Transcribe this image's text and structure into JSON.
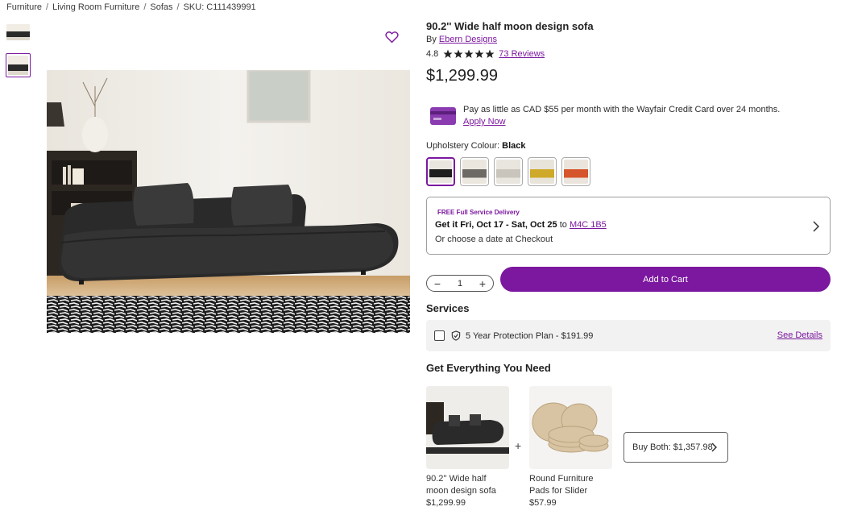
{
  "breadcrumb": [
    "Furniture",
    "Living Room Furniture",
    "Sofas",
    "SKU: C111439991"
  ],
  "product": {
    "title": "90.2'' Wide half moon design sofa",
    "by_prefix": "By",
    "brand": "Ebern Designs",
    "rating": "4.8",
    "stars": 5,
    "reviews": "73 Reviews",
    "price": "$1,299.99"
  },
  "credit": {
    "text": "Pay as little as CAD $55 per month with the Wayfair Credit Card over 24 months.",
    "link": "Apply Now"
  },
  "upholstery": {
    "label": "Upholstery Colour:",
    "value": "Black",
    "swatches": [
      {
        "name": "Black",
        "colors": [
          "#e9e5df",
          "#1e1e1e"
        ]
      },
      {
        "name": "Grey",
        "colors": [
          "#ece7de",
          "#6d6a66"
        ]
      },
      {
        "name": "Cream",
        "colors": [
          "#e9e6e0",
          "#c9c5bd"
        ]
      },
      {
        "name": "Yellow",
        "colors": [
          "#e8e4da",
          "#cfa92a"
        ]
      },
      {
        "name": "Orange",
        "colors": [
          "#ebe4dc",
          "#d6542b"
        ]
      }
    ]
  },
  "delivery": {
    "badge": "FREE Full Service Delivery",
    "get_it_prefix": "Get it",
    "dates": "Fri, Oct 17 - Sat, Oct 25",
    "to": "to",
    "postal": "M4C 1B5",
    "choose": "Or choose a date at Checkout"
  },
  "cart": {
    "quantity": "1",
    "minus": "−",
    "plus": "+",
    "add_label": "Add to Cart"
  },
  "services": {
    "heading": "Services",
    "plan": "5 Year Protection Plan - $191.99",
    "details": "See Details"
  },
  "bundle": {
    "heading": "Get Everything You Need",
    "plus": "+",
    "items": [
      {
        "name": "90.2'' Wide half moon design sofa",
        "price": "$1,299.99"
      },
      {
        "name": "Round Furniture Pads for Slider",
        "price": "$57.99"
      }
    ],
    "buy_both": "Buy Both: $1,357.98"
  },
  "colors": {
    "accent": "#7b189f"
  }
}
